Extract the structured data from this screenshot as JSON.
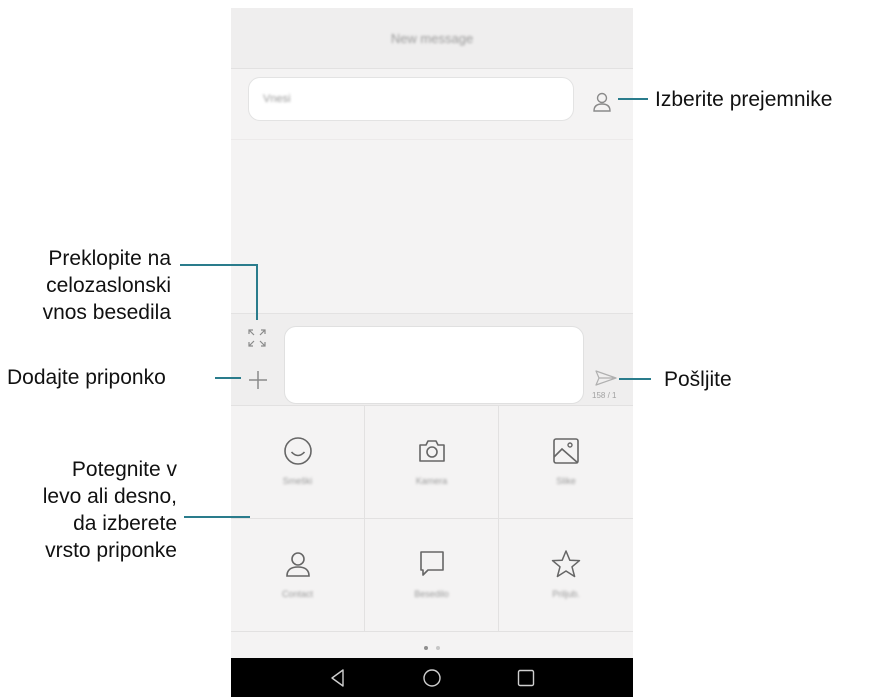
{
  "screen": {
    "title": "New message",
    "recipient_placeholder": "Vnesi",
    "counter": "158 / 1",
    "attachments": [
      {
        "icon": "smiley-icon",
        "label": "Smeški"
      },
      {
        "icon": "camera-icon",
        "label": "Kamera"
      },
      {
        "icon": "image-icon",
        "label": "Slike"
      },
      {
        "icon": "contact-icon",
        "label": "Contact"
      },
      {
        "icon": "message-icon",
        "label": "Besedilo"
      },
      {
        "icon": "star-icon",
        "label": "Priljub."
      }
    ]
  },
  "callouts": {
    "recipients": "Izberite prejemnike",
    "fullscreen_1": "Preklopite na",
    "fullscreen_2": "celozaslonski",
    "fullscreen_3": "vnos besedila",
    "attach": "Dodajte priponko",
    "send": "Pošljite",
    "swipe_1": "Potegnite v",
    "swipe_2": "levo ali desno,",
    "swipe_3": "da izberete",
    "swipe_4": "vrsto priponke"
  },
  "colors": {
    "accent_line": "#2a7c8c",
    "navbar": "#000000"
  }
}
